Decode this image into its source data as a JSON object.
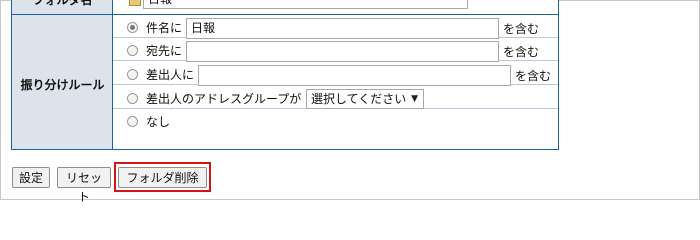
{
  "top_row": {
    "label": "フォルダ名",
    "folder_name_value": "日報"
  },
  "rules": {
    "label": "振り分けルール",
    "options": [
      {
        "label": "件名に",
        "value": "日報",
        "suffix": "を含む",
        "checked": true
      },
      {
        "label": "宛先に",
        "value": "",
        "suffix": "を含む",
        "checked": false
      },
      {
        "label": "差出人に",
        "value": "",
        "suffix": "を含む",
        "checked": false
      },
      {
        "label": "差出人のアドレスグループが",
        "checked": false
      },
      {
        "label": "なし",
        "checked": false
      }
    ],
    "address_group_select": {
      "selected": "選択してください",
      "arrow": "▼"
    }
  },
  "buttons": {
    "settings": "設定",
    "reset": "リセット",
    "delete_folder": "フォルダ削除"
  },
  "colors": {
    "table_border": "#1f5fa8",
    "label_background": "#dde3ea",
    "highlight": "#d41414"
  }
}
